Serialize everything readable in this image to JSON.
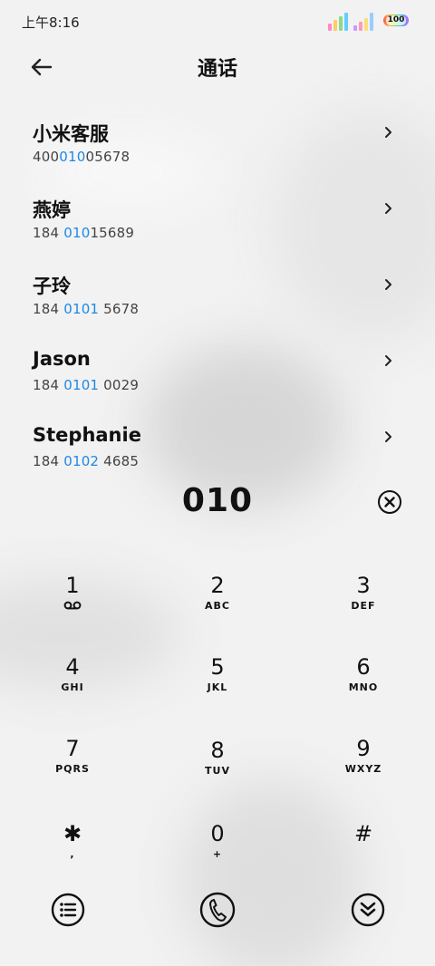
{
  "status_bar": {
    "time": "上午8:16",
    "battery": "100"
  },
  "header": {
    "title": "通话"
  },
  "contacts": [
    {
      "name": "小米客服",
      "number_pre": "400",
      "number_match": "010",
      "number_post": "05678"
    },
    {
      "name": "燕婷",
      "number_pre": "184 ",
      "number_match": "010",
      "number_post": "15689"
    },
    {
      "name": "子玲",
      "number_pre": "184 ",
      "number_match": "0101",
      "number_post": " 5678"
    },
    {
      "name": "Jason",
      "number_pre": "184 ",
      "number_match": "0101",
      "number_post": " 0029"
    },
    {
      "name": "Stephanie",
      "number_pre": "184 ",
      "number_match": "0102",
      "number_post": " 4685"
    }
  ],
  "dialer": {
    "number": "010"
  },
  "keypad": [
    {
      "digit": "1",
      "letters": ""
    },
    {
      "digit": "2",
      "letters": "ABC"
    },
    {
      "digit": "3",
      "letters": "DEF"
    },
    {
      "digit": "4",
      "letters": "GHI"
    },
    {
      "digit": "5",
      "letters": "JKL"
    },
    {
      "digit": "6",
      "letters": "MNO"
    },
    {
      "digit": "7",
      "letters": "PQRS"
    },
    {
      "digit": "8",
      "letters": "TUV"
    },
    {
      "digit": "9",
      "letters": "WXYZ"
    },
    {
      "digit": "✱",
      "letters": ","
    },
    {
      "digit": "0",
      "letters": "+"
    },
    {
      "digit": "#",
      "letters": ""
    }
  ],
  "icons": {
    "back": "back-arrow-icon",
    "chevron": "chevron-right-icon",
    "delete": "delete-icon",
    "voicemail": "voicemail-icon",
    "menu": "menu-list-icon",
    "call": "phone-icon",
    "collapse": "collapse-keypad-icon"
  },
  "colors": {
    "highlight": "#1e88e5",
    "text": "#111111"
  }
}
